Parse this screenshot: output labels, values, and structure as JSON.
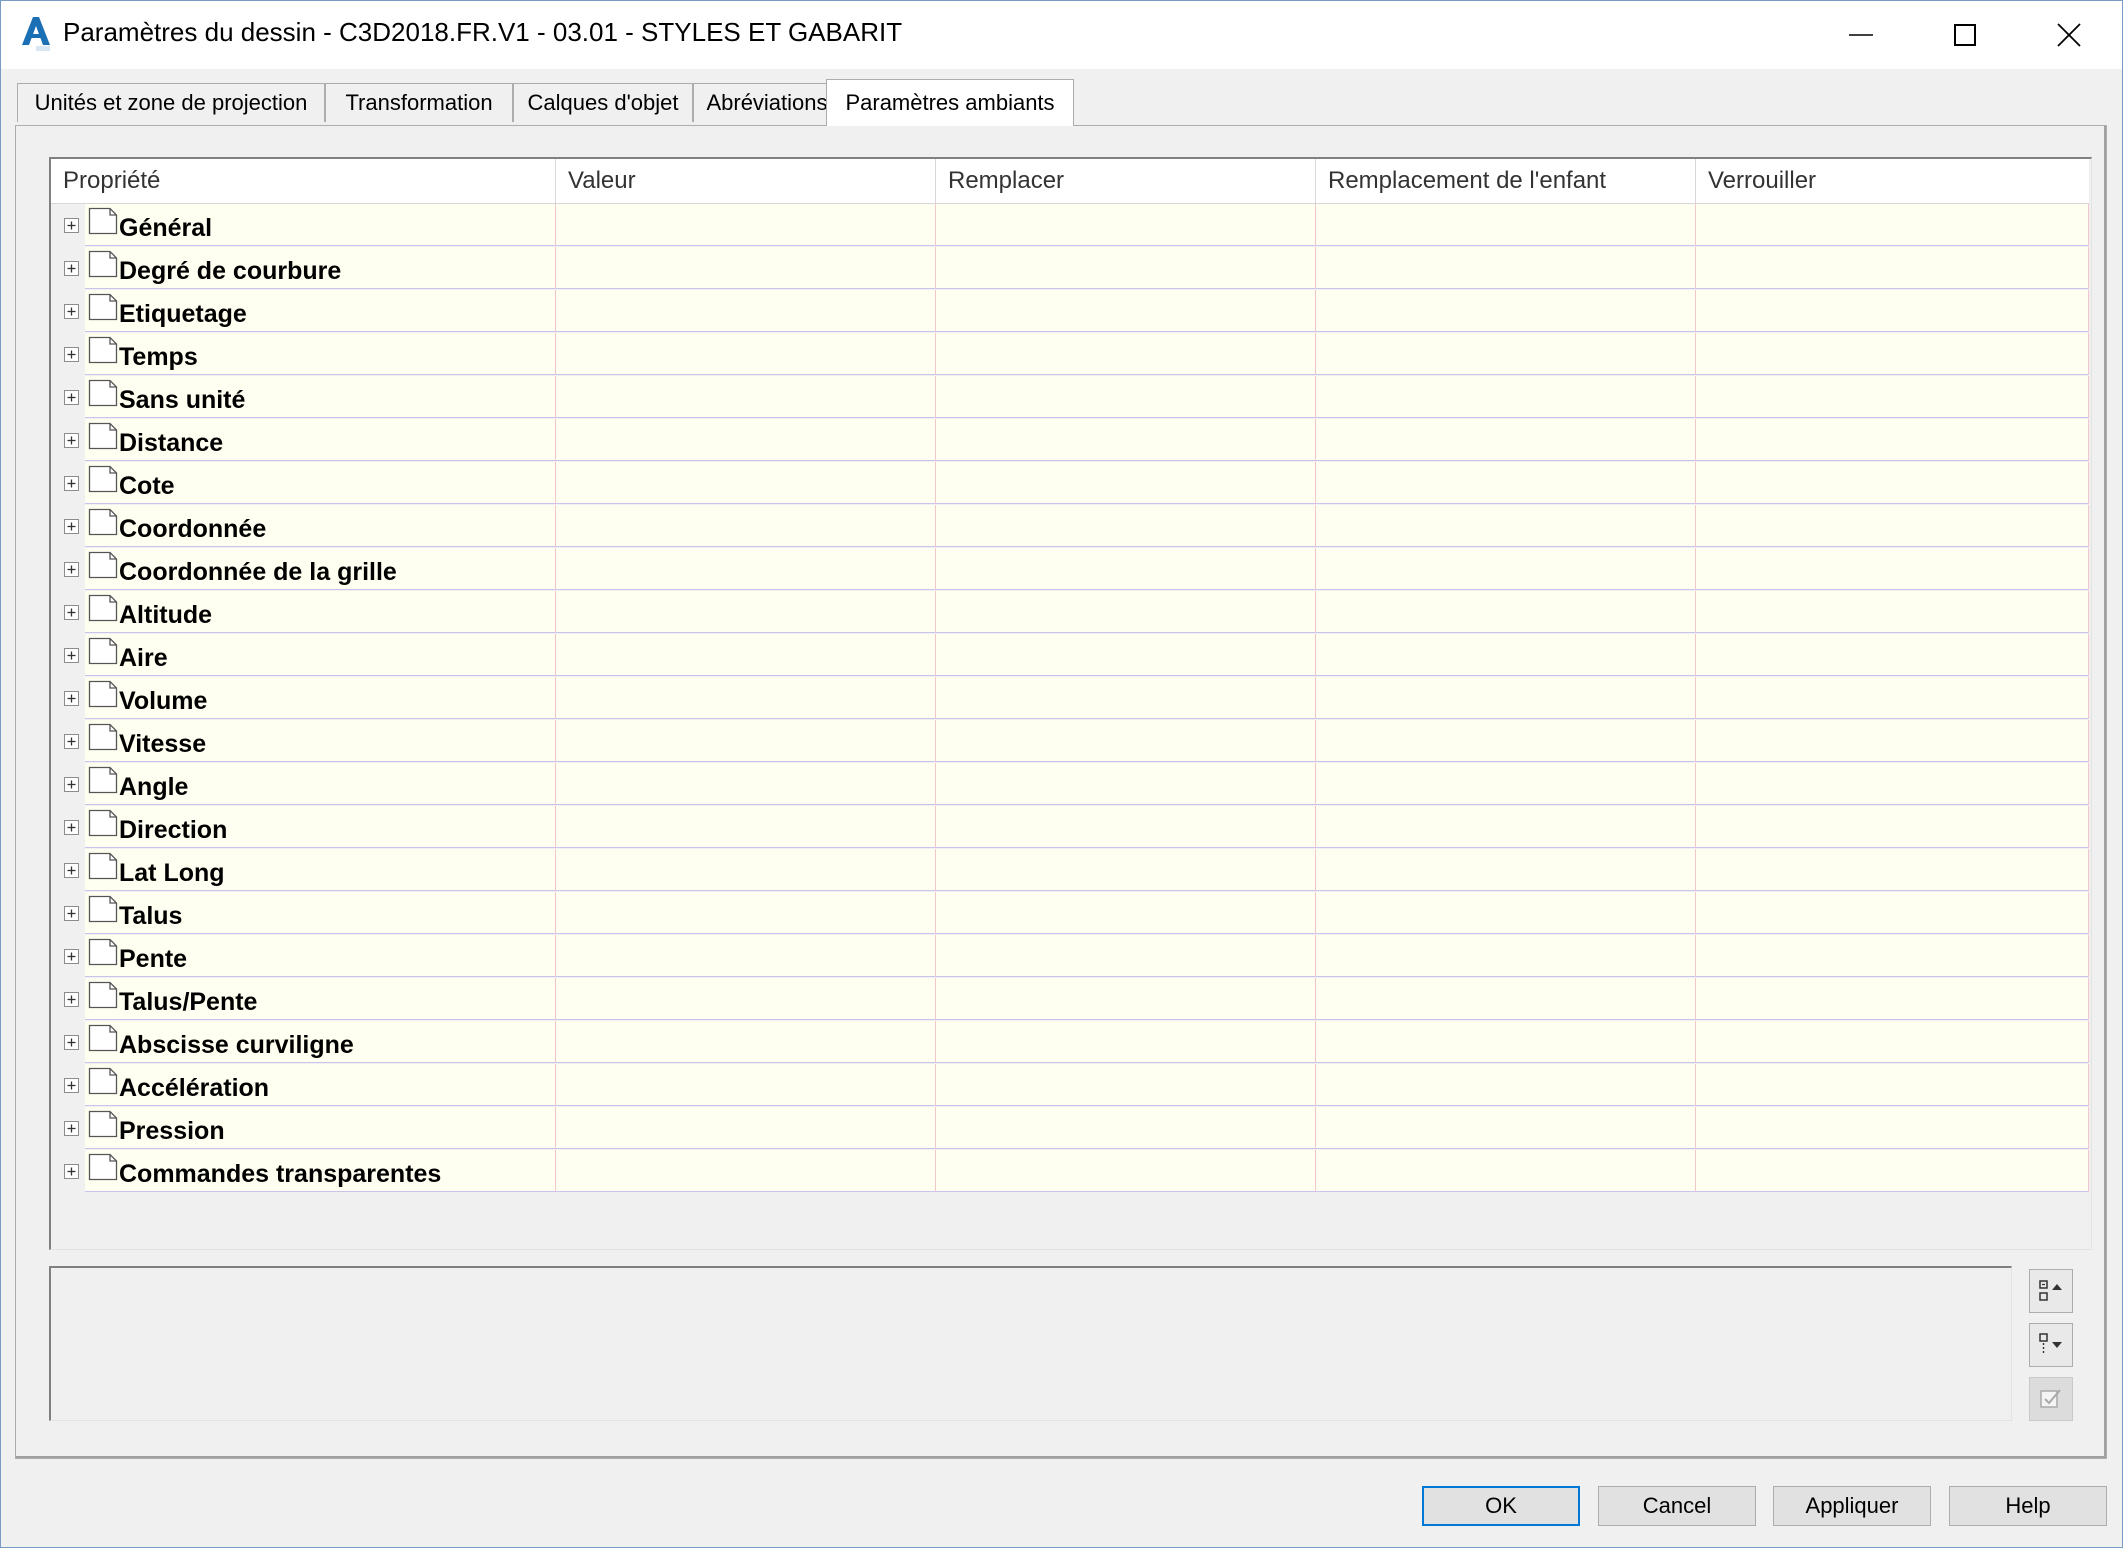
{
  "window": {
    "title": "Paramètres du dessin - C3D2018.FR.V1 - 03.01 - STYLES ET GABARIT",
    "app_icon": "autocad-civil3d-icon",
    "controls": [
      "minimize-icon",
      "maximize-icon",
      "close-icon"
    ]
  },
  "tabs": [
    {
      "label": "Unités et zone de projection",
      "active": false
    },
    {
      "label": "Transformation",
      "active": false
    },
    {
      "label": "Calques d'objet",
      "active": false
    },
    {
      "label": "Abréviations",
      "active": false
    },
    {
      "label": "Paramètres ambiants",
      "active": true
    }
  ],
  "grid": {
    "columns": [
      "Propriété",
      "Valeur",
      "Remplacer",
      "Remplacement de l'enfant",
      "Verrouiller"
    ],
    "rows": [
      "Général",
      "Degré de courbure",
      "Etiquetage",
      "Temps",
      "Sans unité",
      "Distance",
      "Cote",
      "Coordonnée",
      "Coordonnée de la grille",
      "Altitude",
      "Aire",
      "Volume",
      "Vitesse",
      "Angle",
      "Direction",
      "Lat Long",
      "Talus",
      "Pente",
      "Talus/Pente",
      "Abscisse curviligne",
      "Accélération",
      "Pression",
      "Commandes transparentes"
    ],
    "row_icons": [
      "expand-plus-icon",
      "document-icon"
    ]
  },
  "side_buttons": [
    {
      "icon": "collapse-all-icon",
      "enabled": true
    },
    {
      "icon": "expand-all-icon",
      "enabled": true
    },
    {
      "icon": "check-icon",
      "enabled": false
    }
  ],
  "buttons": {
    "ok": "OK",
    "cancel": "Cancel",
    "apply": "Appliquer",
    "help": "Help"
  },
  "colors": {
    "row_background": "#fffff1",
    "row_separator": "#c9c4ec",
    "column_separator": "#f3c6cd",
    "default_button_border": "#0078d7",
    "app_icon": "#1b6fb5"
  }
}
